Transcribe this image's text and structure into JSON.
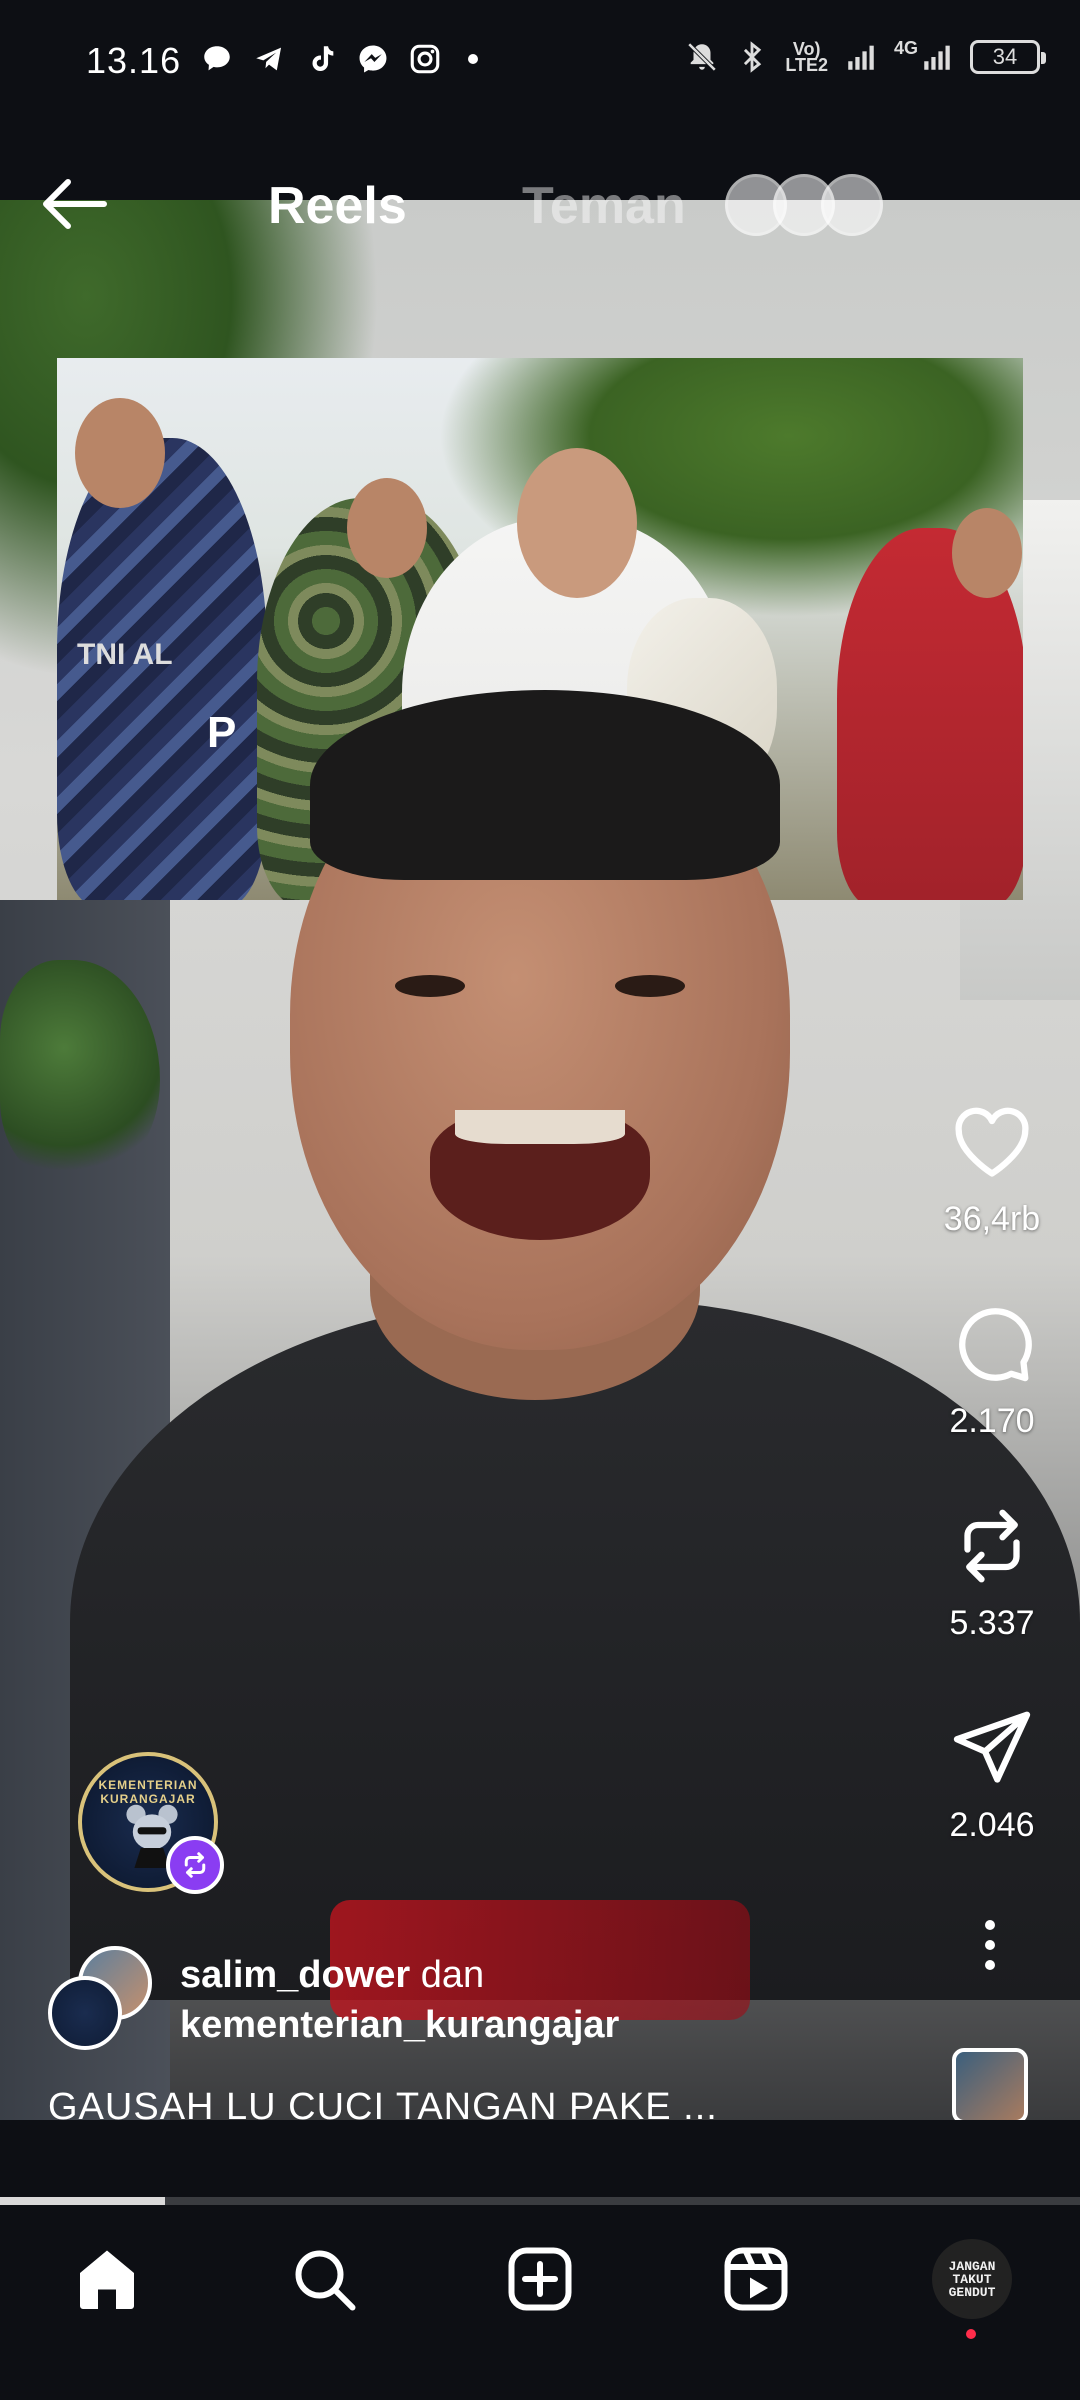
{
  "status_bar": {
    "time": "13.16",
    "left_icons": [
      "chat-bubble-icon",
      "telegram-icon",
      "tiktok-icon",
      "messenger-icon",
      "instagram-icon"
    ],
    "right_icons": [
      "mute-bell-icon",
      "bluetooth-icon",
      "volte-icon",
      "signal-icon",
      "4g-signal-icon"
    ],
    "volte_label": "Vo)\nLTE2",
    "network_label": "4G",
    "battery": "34"
  },
  "header": {
    "back_icon": "back-arrow-icon",
    "tabs": [
      {
        "label": "Reels",
        "active": true
      },
      {
        "label": "Teman",
        "active": false
      }
    ]
  },
  "actions": {
    "likes": "36,4rb",
    "comments": "2.170",
    "reposts": "5.337",
    "shares": "2.046"
  },
  "creator": {
    "user1": "salim_dower",
    "joiner": "dan",
    "user2": "kementerian_kurangajar",
    "badge_text": "KEMENTERIAN KURANGAJAR",
    "caption": "GAUSAH LU CUCI TANGAN PAKE ..."
  },
  "inset_photo": {
    "label_small": "TNI AL",
    "label_large": "P"
  },
  "playback": {
    "progress": 0.153
  },
  "bottom_nav": {
    "items": [
      "home-icon",
      "search-icon",
      "create-icon",
      "reels-icon",
      "profile-avatar"
    ],
    "profile_text": "JANGAN TAKUT GENDUT"
  },
  "colors": {
    "background": "#0d0f14",
    "remix_badge": "#8a3df2",
    "notification_dot": "#ff2d4b"
  }
}
